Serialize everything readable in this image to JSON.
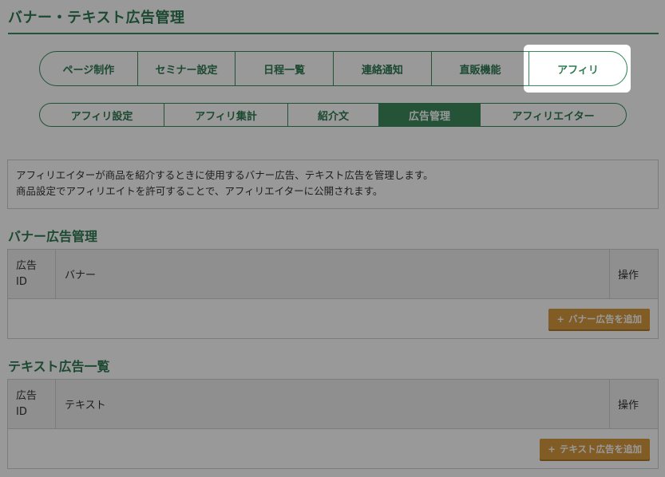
{
  "page": {
    "title": "バナー・テキスト広告管理"
  },
  "main_nav": {
    "tabs": [
      {
        "label": "ページ制作"
      },
      {
        "label": "セミナー設定"
      },
      {
        "label": "日程一覧"
      },
      {
        "label": "連絡通知"
      },
      {
        "label": "直販機能"
      },
      {
        "label": "アフィリ"
      }
    ]
  },
  "sub_nav": {
    "tabs": [
      {
        "label": "アフィリ設定"
      },
      {
        "label": "アフィリ集計"
      },
      {
        "label": "紹介文"
      },
      {
        "label": "広告管理",
        "active": true
      },
      {
        "label": "アフィリエイター"
      }
    ]
  },
  "info": {
    "line1": "アフィリエイターが商品を紹介するときに使用するバナー広告、テキスト広告を管理します。",
    "line2": "商品設定でアフィリエイトを許可することで、アフィリエイターに公開されます。"
  },
  "banner_section": {
    "title": "バナー広告管理",
    "col_id_line1": "広告",
    "col_id_line2": "ID",
    "col_main": "バナー",
    "col_op": "操作",
    "add_button": "バナー広告を追加",
    "add_icon": "+"
  },
  "text_section": {
    "title": "テキスト広告一覧",
    "col_id_line1": "広告",
    "col_id_line2": "ID",
    "col_main": "テキスト",
    "col_op": "操作",
    "add_button": "テキスト広告を追加",
    "add_icon": "+"
  },
  "colors": {
    "brand_green": "#2f7a52",
    "active_tab": "#3d8a5e",
    "add_button": "#d99a3e"
  }
}
